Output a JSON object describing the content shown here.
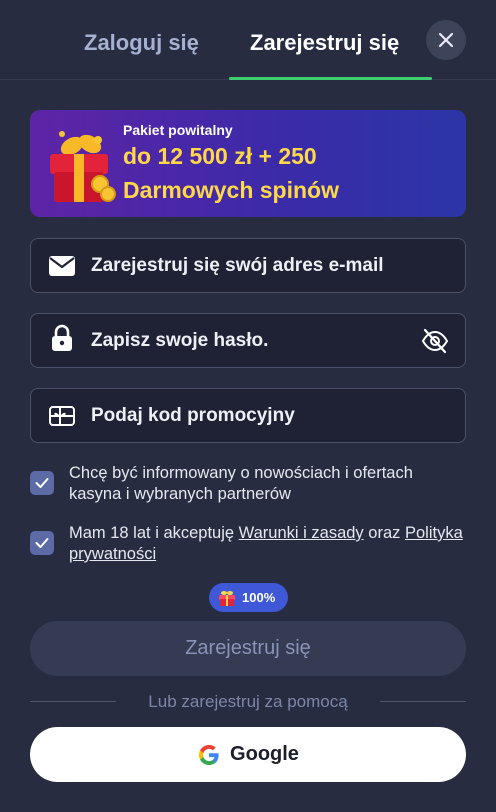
{
  "tabs": {
    "login": "Zaloguj się",
    "register": "Zarejestruj się",
    "active": "register"
  },
  "banner": {
    "subtitle": "Pakiet powitalny",
    "line1": "do 12 500 zł + 250",
    "line2": "Darmowych spinów"
  },
  "fields": {
    "email_placeholder": "Zarejestruj się swój adres e-mail",
    "password_placeholder": "Zapisz swoje hasło.",
    "promo_placeholder": "Podaj kod promocyjny"
  },
  "consents": {
    "marketing_text": "Chcę być informowany o nowościach i ofertach kasyna i wybranych partnerów",
    "marketing_checked": true,
    "terms_prefix": "Mam 18 lat i akceptuję ",
    "terms_link": "Warunki i zasady",
    "terms_mid": " oraz ",
    "privacy_link": "Polityka prywatności",
    "terms_checked": true
  },
  "bonus_badge": "100%",
  "submit_label": "Zarejestruj się",
  "divider_text": "Lub zarejestruj za pomocą",
  "google_label": "Google",
  "colors": {
    "background": "#272c40",
    "field_bg": "#1e2234",
    "accent_green": "#3ecf71",
    "banner_text": "#ffd84a",
    "checkbox": "#5c6aa6",
    "badge": "#3e58d8"
  },
  "icons": [
    "close-icon",
    "gift-icon",
    "mail-icon",
    "lock-icon",
    "eye-off-icon",
    "gift-card-icon",
    "check-icon",
    "google-icon"
  ]
}
